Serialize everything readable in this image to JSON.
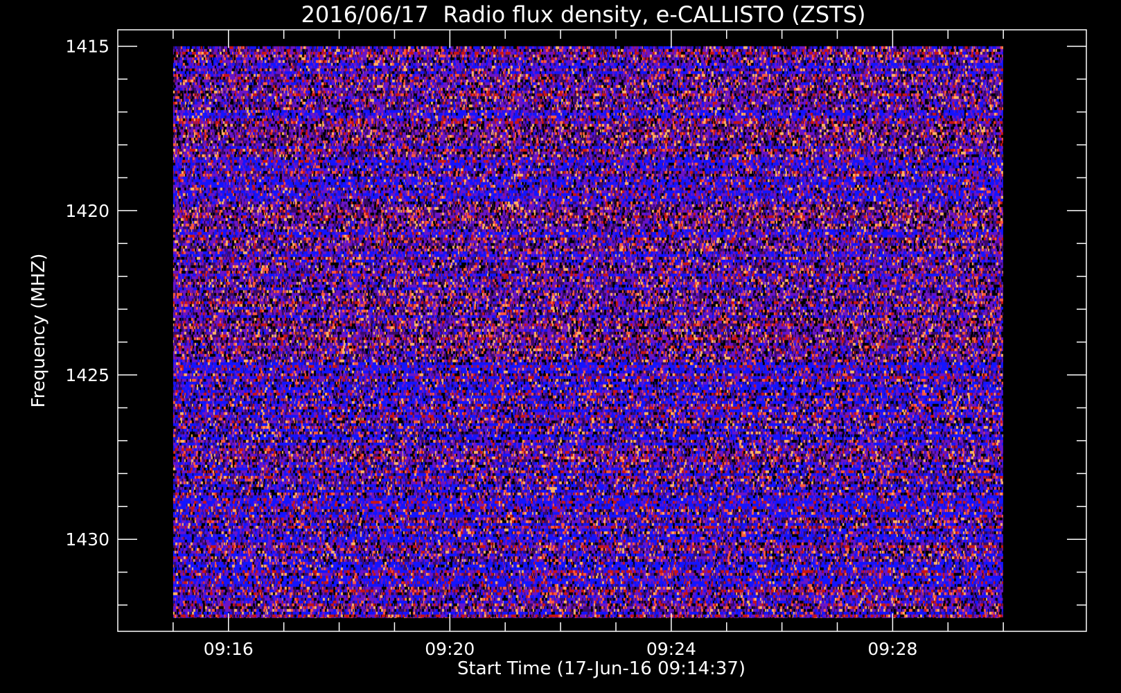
{
  "chart_data": {
    "type": "heatmap",
    "title": "2016/06/17  Radio flux density, e-CALLISTO (ZSTS)",
    "xlabel": "Start Time (17-Jun-16 09:14:37)",
    "ylabel": "Frequency (MHZ)",
    "x_range_minutes": [
      "09:14:37",
      "09:30:00"
    ],
    "xlim": [
      "09:14:00",
      "09:31:30"
    ],
    "ylim": [
      1414.5,
      1432.8
    ],
    "y_inverted": true,
    "data_extent": {
      "t_start": "09:15:00",
      "t_end": "09:30:00",
      "f_start": 1415.0,
      "f_end": 1432.4
    },
    "x_ticks": [
      {
        "label": "09:16",
        "value": "09:16"
      },
      {
        "label": "09:20",
        "value": "09:20"
      },
      {
        "label": "09:24",
        "value": "09:24"
      },
      {
        "label": "09:28",
        "value": "09:28"
      }
    ],
    "x_minor_ticks": [
      "09:15",
      "09:16",
      "09:17",
      "09:18",
      "09:19",
      "09:20",
      "09:21",
      "09:22",
      "09:23",
      "09:24",
      "09:25",
      "09:26",
      "09:27",
      "09:28",
      "09:29",
      "09:30"
    ],
    "y_ticks": [
      {
        "label": "1415",
        "value": 1415
      },
      {
        "label": "1420",
        "value": 1420
      },
      {
        "label": "1425",
        "value": 1425
      },
      {
        "label": "1430",
        "value": 1430
      }
    ],
    "y_minor_ticks": [
      1415,
      1416,
      1417,
      1418,
      1419,
      1420,
      1421,
      1422,
      1423,
      1424,
      1425,
      1426,
      1427,
      1428,
      1429,
      1430,
      1431,
      1432
    ],
    "colormap": [
      "#000000",
      "#3a0a6a",
      "#6a14c8",
      "#1414ff",
      "#c81414",
      "#ff5a3c",
      "#ffb464"
    ],
    "background": "#000000",
    "foreground": "#ffffff",
    "grid": false,
    "description": "Dense noisy spectrogram with strong horizontal blue and red banding across all times"
  }
}
